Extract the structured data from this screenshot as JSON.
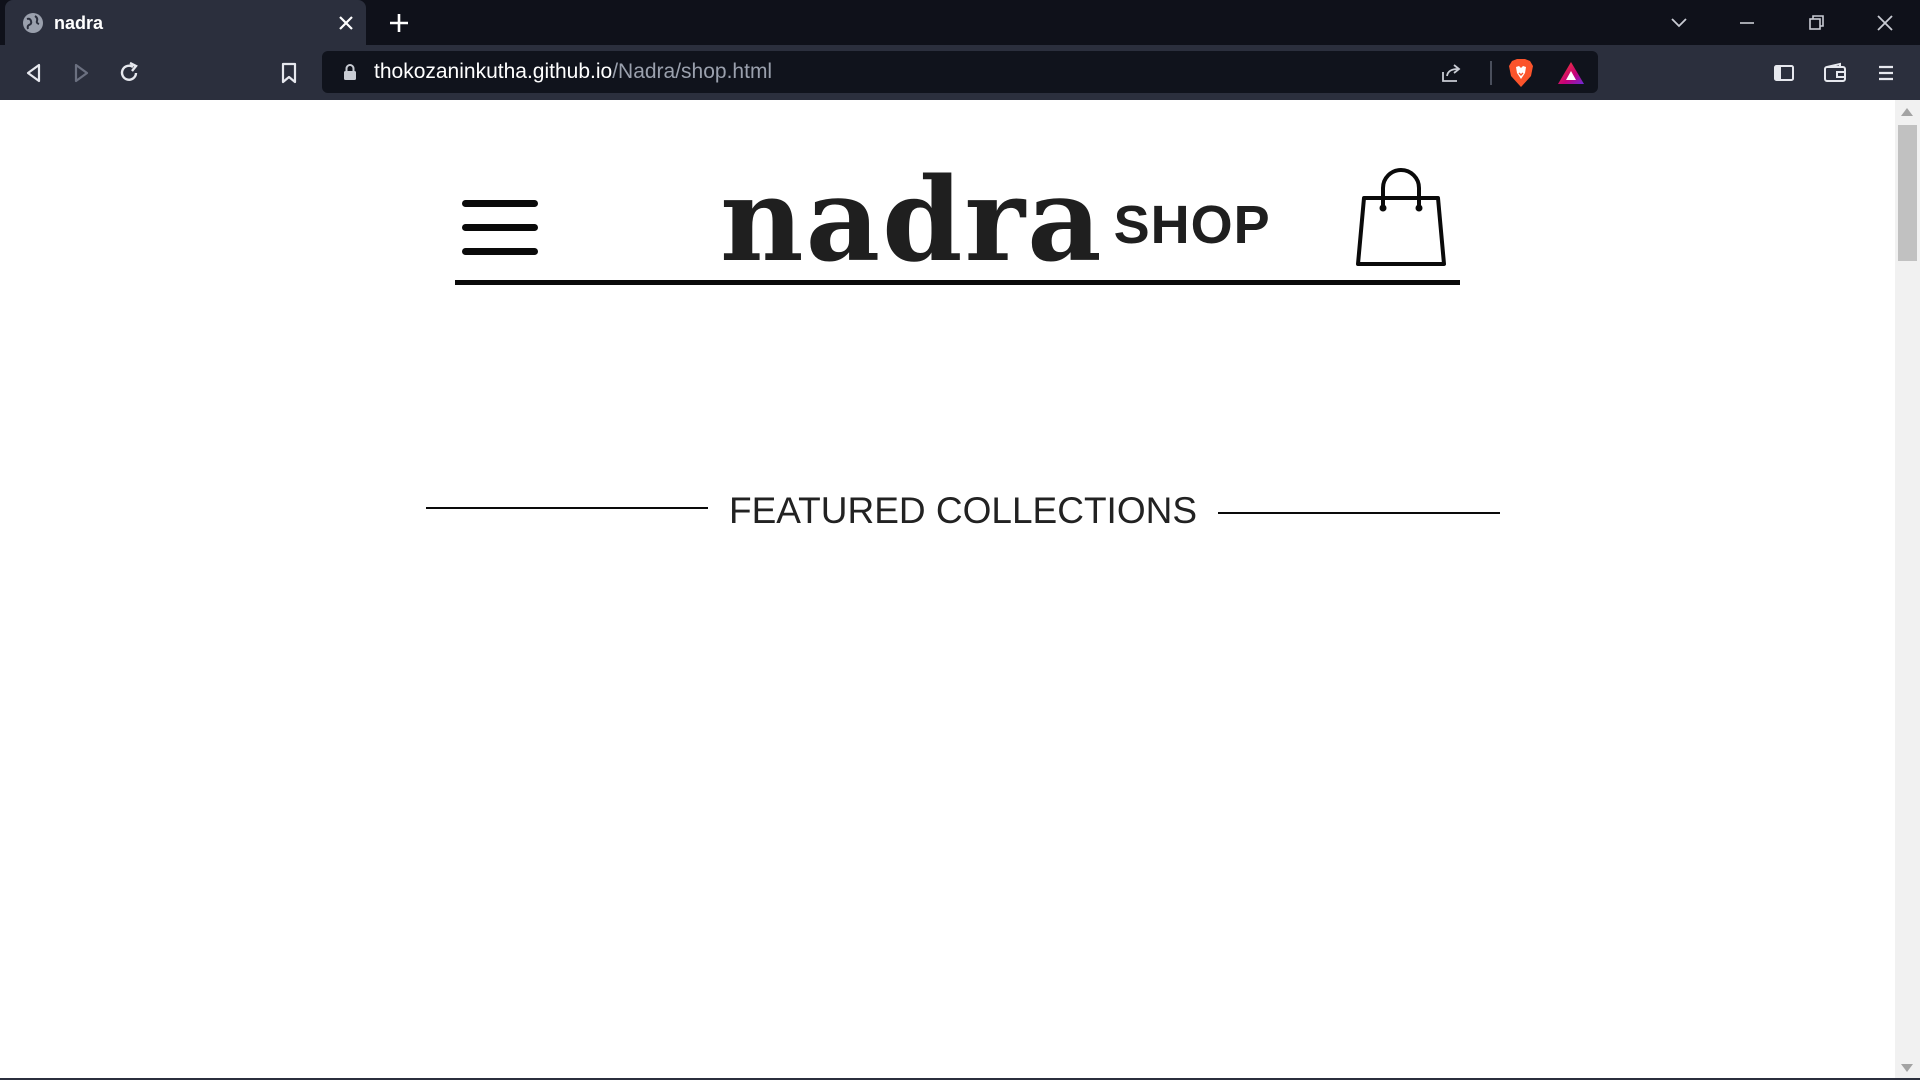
{
  "browser": {
    "tab": {
      "title": "nadra"
    },
    "address_bar": {
      "host": "thokozaninkutha.github.io",
      "path": "/Nadra/shop.html"
    },
    "icons": {
      "tab_favicon": "globe-icon",
      "close_tab": "close-icon",
      "new_tab": "plus-icon",
      "tab_search": "chevron-down-icon",
      "minimize": "minimize-icon",
      "restore": "restore-icon",
      "close_window": "close-icon",
      "back": "back-arrow-icon",
      "forward": "forward-arrow-icon",
      "reload": "reload-icon",
      "bookmark": "bookmark-icon",
      "lock": "lock-icon",
      "share": "share-icon",
      "brave_shields": "brave-lion-icon",
      "brave_rewards": "rewards-triangle-icon",
      "sidebar": "sidebar-icon",
      "wallet": "wallet-icon",
      "menu": "menu-icon"
    }
  },
  "site": {
    "logo": {
      "word": "nadra",
      "sub": "SHOP"
    },
    "menu_icon": "hamburger-icon",
    "cart_icon": "shopping-bag-icon",
    "featured": {
      "title": "FEATURED COLLECTIONS"
    }
  },
  "colors": {
    "chrome_dark": "#0f111a",
    "chrome_toolbar": "#2b2f3d",
    "omnibox": "#10131c",
    "page_bg": "#ffffff",
    "ink": "#0a0a0a",
    "brave_orange": "#fb542b"
  }
}
